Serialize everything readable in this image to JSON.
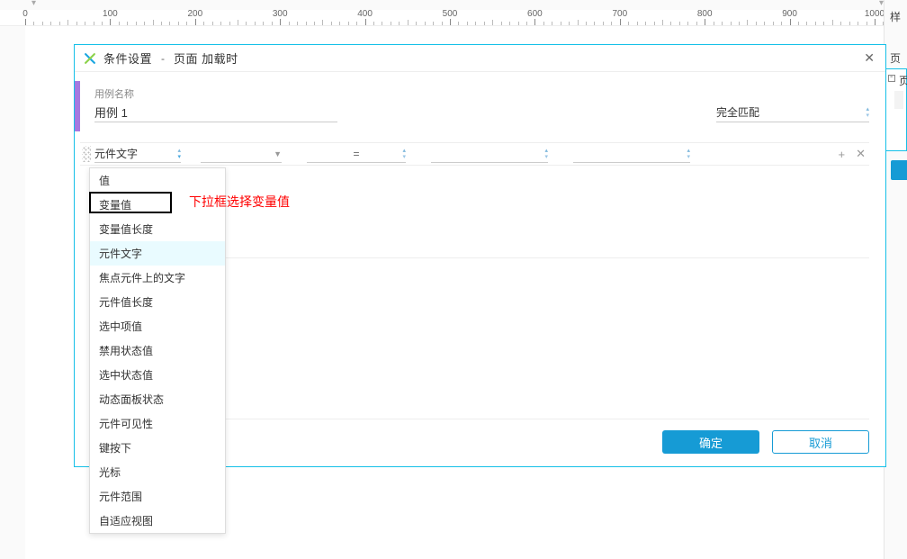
{
  "ruler": {
    "start": 0,
    "end": 1000,
    "major": 100
  },
  "right_panel": {
    "tab1": "样",
    "tab2": "页",
    "glyph": "页"
  },
  "dialog": {
    "title_a": "条件设置",
    "title_b": "页面 加载时",
    "close_glyph": "✕",
    "case_label": "用例名称",
    "case_value": "用例 1",
    "match_mode": "完全匹配",
    "condition": {
      "field": "元件文字",
      "op": "=",
      "add_glyph": "+",
      "remove_glyph": "✕"
    },
    "dropdown": {
      "items": [
        "值",
        "变量值",
        "变量值长度",
        "元件文字",
        "焦点元件上的文字",
        "元件值长度",
        "选中项值",
        "禁用状态值",
        "选中状态值",
        "动态面板状态",
        "元件可见性",
        "键按下",
        "光标",
        "元件范围",
        "自适应视图"
      ],
      "highlighted_index": 3,
      "boxed_index": 1
    },
    "annotation": "下拉框选择变量值",
    "ok": "确定",
    "cancel": "取消"
  }
}
